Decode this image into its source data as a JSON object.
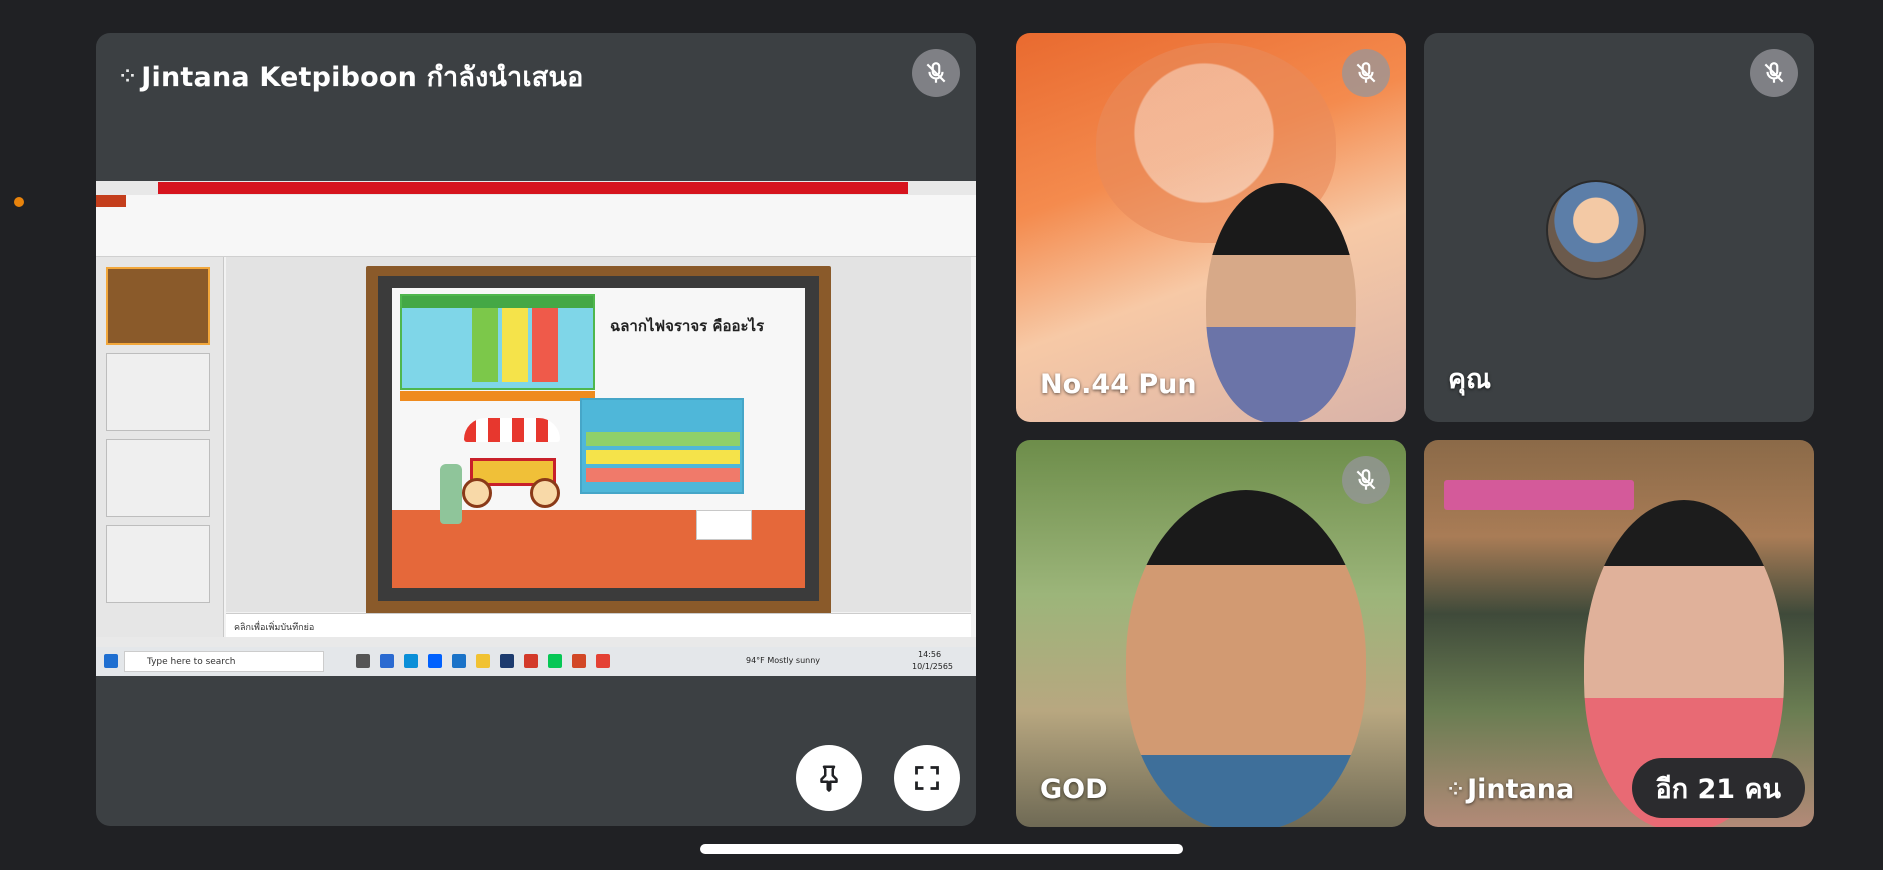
{
  "presenter": {
    "title": "Jintana Ketpiboon กำลังนำเสนอ"
  },
  "shared_screen": {
    "notes_placeholder": "คลิกเพื่อเพิ่มบันทึกย่อ",
    "taskbar_search_placeholder": "Type here to search",
    "weather": "94°F  Mostly sunny",
    "clock_time": "14:56",
    "clock_date": "10/1/2565",
    "slide_heading": "ฉลากไฟจราจร คืออะไร"
  },
  "participants": [
    {
      "name": "No.44 Pun",
      "muted": true
    },
    {
      "name": "คุณ",
      "muted": true
    },
    {
      "name": "GOD",
      "muted": true
    },
    {
      "name": "Jintana",
      "muted": false
    }
  ],
  "more_participants": "อีก 21 คน",
  "controls": {
    "pin_icon": "pin-icon",
    "fullscreen_icon": "fullscreen-icon",
    "mic_off_icon": "mic-off-icon"
  },
  "colors": {
    "background": "#202124",
    "tile": "#3c4043",
    "accent_orange": "#e8830c"
  }
}
